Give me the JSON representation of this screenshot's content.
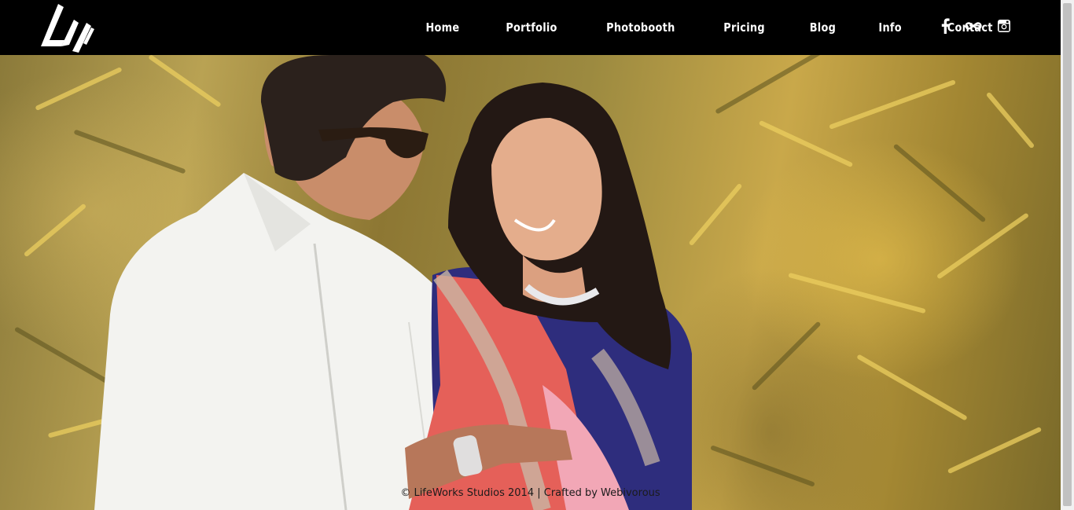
{
  "brand": {
    "logo_icon": "lifeworks-logo-icon"
  },
  "nav": {
    "items": [
      {
        "label": "Home"
      },
      {
        "label": "Portfolio"
      },
      {
        "label": "Photobooth"
      },
      {
        "label": "Pricing"
      },
      {
        "label": "Blog"
      },
      {
        "label": "Info"
      },
      {
        "label": "Contact"
      }
    ]
  },
  "social": {
    "icons": [
      "facebook-icon",
      "flickr-infinity-icon",
      "instagram-icon"
    ]
  },
  "hero": {
    "image": "couple-photo",
    "background_color": "#a08a3a"
  },
  "footer": {
    "text": "© LifeWorks Studios 2014 | Crafted by Webivorous"
  },
  "colors": {
    "header_bg": "#000000",
    "nav_text": "#ffffff"
  }
}
